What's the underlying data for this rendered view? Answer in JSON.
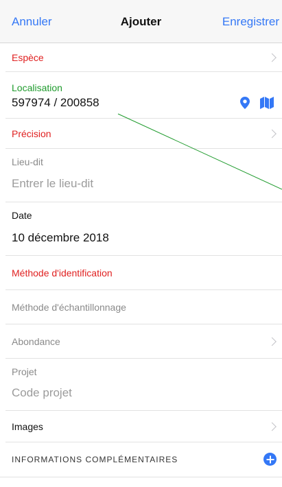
{
  "navbar": {
    "cancel": "Annuler",
    "title": "Ajouter",
    "save": "Enregistrer"
  },
  "form": {
    "espece": {
      "label": "Espèce"
    },
    "localisation": {
      "label": "Localisation",
      "value": "597974 / 200858"
    },
    "precision": {
      "label": "Précision"
    },
    "lieu_dit": {
      "label": "Lieu-dit",
      "placeholder": "Entrer le lieu-dit"
    },
    "date": {
      "label": "Date",
      "value": "10 décembre 2018"
    },
    "methode_identification": {
      "label": "Méthode d'identification"
    },
    "methode_echantillonnage": {
      "label": "Méthode d'échantillonnage"
    },
    "abondance": {
      "label": "Abondance"
    },
    "projet": {
      "label": "Projet",
      "placeholder": "Code projet"
    },
    "images": {
      "label": "Images"
    },
    "infos": {
      "label": "INFORMATIONS COMPLÉMENTAIRES"
    }
  },
  "colors": {
    "accent": "#3478f6",
    "required": "#e02020",
    "valid": "#1f9b2d"
  },
  "icons": {
    "pin": "location-pin-icon",
    "map": "map-icon",
    "plus": "plus-circle-icon",
    "chevron": "chevron-right-icon"
  }
}
